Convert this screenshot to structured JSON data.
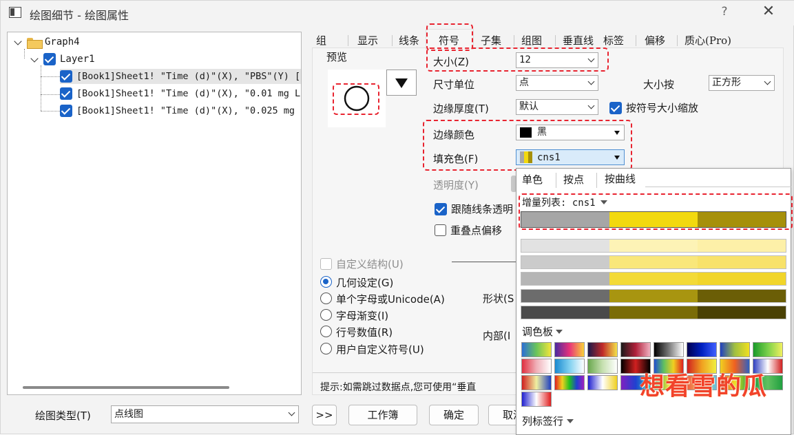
{
  "window": {
    "title": "绘图细节 - 绘图属性",
    "help": "?",
    "close": "✕"
  },
  "tree": {
    "root": "Graph4",
    "layer": "Layer1",
    "items": [
      "[Book1]Sheet1! \"Time (d)\"(X), \"PBS\"(Y) [",
      "[Book1]Sheet1! \"Time (d)\"(X), \"0.01 mg L",
      "[Book1]Sheet1! \"Time (d)\"(X), \"0.025 mg"
    ]
  },
  "tabs": [
    "组",
    "显示",
    "线条",
    "符号",
    "子集",
    "组图",
    "垂直线",
    "标签",
    "偏移",
    "质心(Pro)"
  ],
  "symbol": {
    "preview_label": "预览",
    "size_label": "大小(Z)",
    "size_value": "12",
    "unit_label": "尺寸单位",
    "unit_value": "点",
    "size_by_label": "大小按",
    "size_by_value": "正方形",
    "edge_thickness_label": "边缘厚度(T)",
    "edge_thickness_value": "默认",
    "scale_with_size_label": "按符号大小缩放",
    "edge_color_label": "边缘颜色",
    "edge_color_value": "黑",
    "fill_color_label": "填充色(F)",
    "fill_color_value": "cns1",
    "transparency_label": "透明度(Y)",
    "follow_line_label": "跟随线条透明",
    "overlap_offset_label": "重叠点偏移",
    "custom_construct_label": "自定义结构(U)",
    "radio_geometry": "几何设定(G)",
    "radio_single_char": "单个字母或Unicode(A)",
    "radio_char_gradient": "字母渐变(I)",
    "radio_row_number": "行号数值(R)",
    "radio_user_symbol": "用户自定义符号(U)",
    "shape_label": "形状(S",
    "interior_label": "内部(I",
    "hint_text": "提示:如需跳过数据点,您可使用“垂直"
  },
  "popup": {
    "tabs": [
      "单色",
      "按点",
      "按曲线"
    ],
    "increment_list_label": "增量列表: cns1",
    "palette_label": "调色板",
    "column_label_label": "列标签行",
    "colors": {
      "gray": "#a6a6a6",
      "yellow": "#f2d90f",
      "olive": "#a6900a"
    }
  },
  "bottom": {
    "plot_type_label": "绘图类型(T)",
    "plot_type_value": "点线图",
    "expand_button": ">>",
    "workbook_button": "工作簿",
    "ok_button": "确定",
    "cancel_button": "取消"
  },
  "watermark": "想看雪的瓜"
}
